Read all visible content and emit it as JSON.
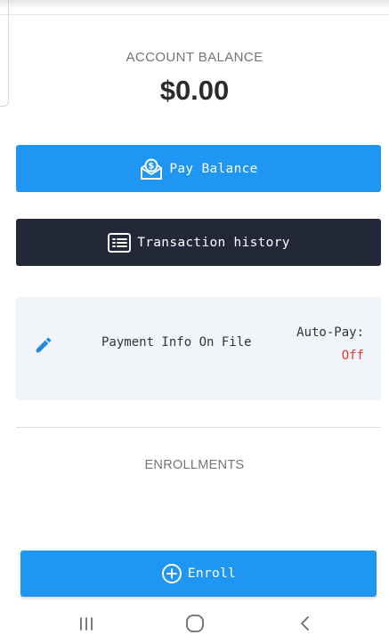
{
  "account": {
    "balance_label": "ACCOUNT BALANCE",
    "balance_amount": "$0.00"
  },
  "actions": {
    "pay_balance_label": "Pay Balance",
    "transaction_history_label": "Transaction history"
  },
  "payment_card": {
    "info_text": "Payment Info On File",
    "autopay_label": "Auto-Pay:",
    "autopay_value": "Off",
    "autopay_color": "#e53935"
  },
  "enrollments": {
    "section_label": "ENROLLMENTS",
    "enroll_label": "Enroll"
  },
  "icons": {
    "pay": "money-envelope-icon",
    "history": "list-icon",
    "edit": "pencil-icon",
    "enroll": "plus-circle-icon",
    "nav_recents": "recents-icon",
    "nav_home": "home-icon",
    "nav_back": "back-icon"
  },
  "colors": {
    "primary": "#1e96f2",
    "dark": "#232838",
    "card_bg": "#f1f5f9"
  }
}
